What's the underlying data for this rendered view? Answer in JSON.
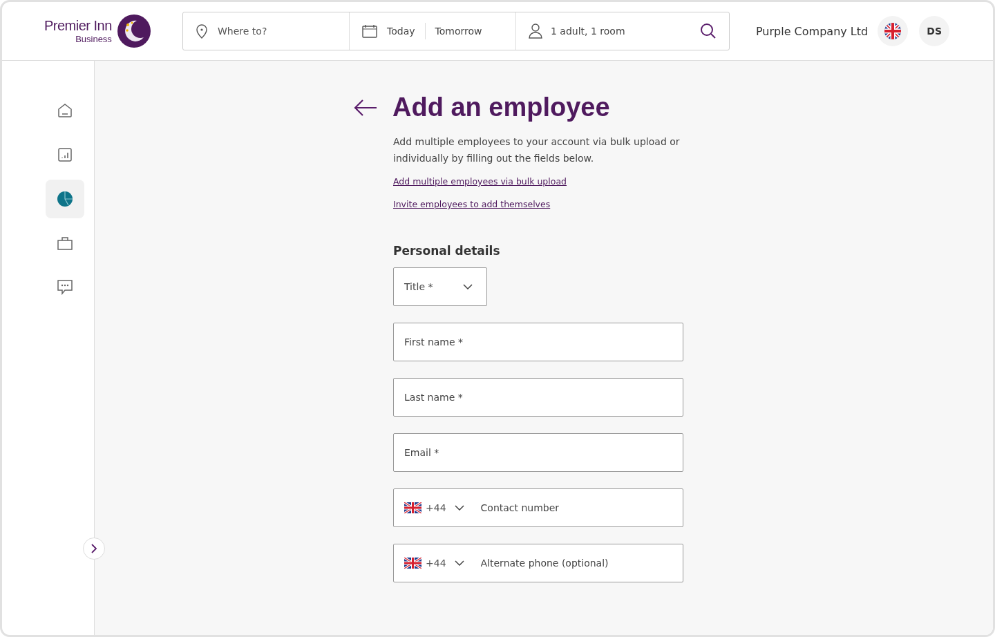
{
  "header": {
    "logo": {
      "name": "Premier Inn",
      "sub": "Business"
    },
    "search": {
      "destination": {
        "placeholder": "Where to?"
      },
      "checkin": "Today",
      "checkout": "Tomorrow",
      "guests": "1 adult, 1 room"
    },
    "company": "Purple Company Ltd",
    "avatar": "DS"
  },
  "sidebar": {
    "items": [
      {
        "kind": "home",
        "selected": false
      },
      {
        "kind": "reports",
        "selected": false
      },
      {
        "kind": "pie",
        "selected": true
      },
      {
        "kind": "bag",
        "selected": false
      },
      {
        "kind": "chat",
        "selected": false
      }
    ]
  },
  "page": {
    "title": "Add an employee",
    "intro": "Add multiple employees to your account via bulk upload or individually by filling out the fields below.",
    "links": [
      "Add multiple employees via bulk upload",
      "Invite employees to add themselves"
    ],
    "section": "Personal details",
    "fields": [
      {
        "kind": "select",
        "placeholder": "Title *"
      },
      {
        "kind": "text",
        "placeholder": "First name *"
      },
      {
        "kind": "text",
        "placeholder": "Last name *"
      },
      {
        "kind": "text",
        "placeholder": "Email *"
      },
      {
        "kind": "phone",
        "code": "+44",
        "placeholder": "Contact number"
      },
      {
        "kind": "phone",
        "code": "+44",
        "placeholder": "Alternate phone (optional)"
      }
    ]
  }
}
